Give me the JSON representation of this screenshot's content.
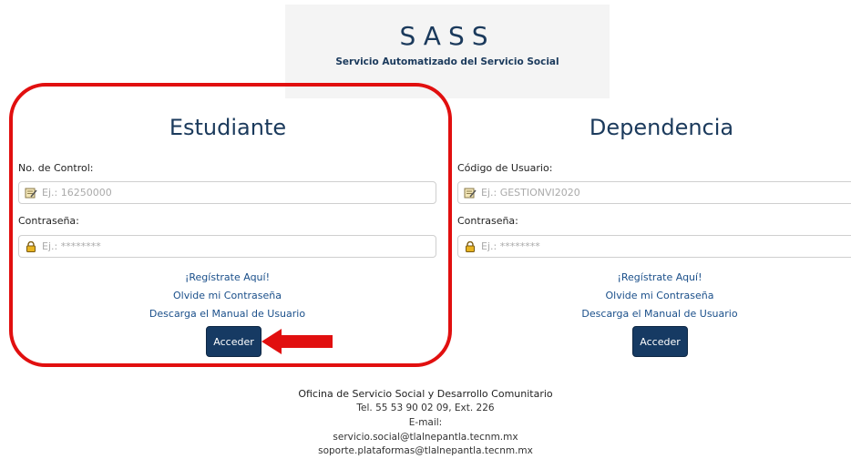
{
  "header": {
    "logo_title": "SASS",
    "logo_subtitle": "Servicio Automatizado del Servicio Social"
  },
  "estudiante": {
    "title": "Estudiante",
    "control_label": "No. de Control:",
    "control_placeholder": "Ej.: 16250000",
    "password_label": "Contraseña:",
    "password_placeholder": "Ej.: ********",
    "register_link": "¡Regístrate Aquí!",
    "forgot_link": "Olvide mi Contraseña",
    "manual_link": "Descarga el Manual de Usuario",
    "submit_label": "Acceder"
  },
  "dependencia": {
    "title": "Dependencia",
    "user_label": "Código de Usuario:",
    "user_placeholder": "Ej.: GESTIONVI2020",
    "password_label": "Contraseña:",
    "password_placeholder": "Ej.: ********",
    "register_link": "¡Regístrate Aquí!",
    "forgot_link": "Olvide mi Contraseña",
    "manual_link": "Descarga el Manual de Usuario",
    "submit_label": "Acceder"
  },
  "footer": {
    "office": "Oficina de Servicio Social y Desarrollo Comunitario",
    "phone": "Tel. 55 53 90 02 09, Ext. 226",
    "email_label": "E-mail:",
    "email_1": "servicio.social@tlalnepantla.tecnm.mx",
    "email_2": "soporte.plataformas@tlalnepantla.tecnm.mx"
  },
  "annotation": {
    "highlight_color": "#e10f0f",
    "arrow_color": "#e10f0f"
  },
  "icons": {
    "user_field": "note-pencil-icon",
    "password_field": "lock-icon"
  }
}
